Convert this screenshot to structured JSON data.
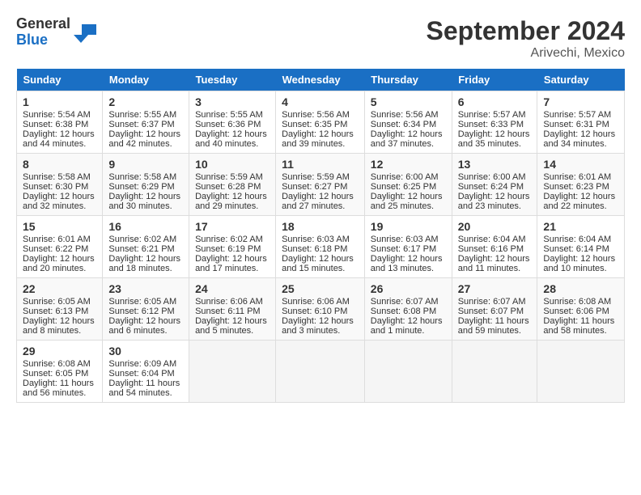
{
  "header": {
    "logo_line1": "General",
    "logo_line2": "Blue",
    "title": "September 2024",
    "subtitle": "Arivechi, Mexico"
  },
  "days_of_week": [
    "Sunday",
    "Monday",
    "Tuesday",
    "Wednesday",
    "Thursday",
    "Friday",
    "Saturday"
  ],
  "weeks": [
    [
      {
        "day": "1",
        "info": "Sunrise: 5:54 AM\nSunset: 6:38 PM\nDaylight: 12 hours\nand 44 minutes."
      },
      {
        "day": "2",
        "info": "Sunrise: 5:55 AM\nSunset: 6:37 PM\nDaylight: 12 hours\nand 42 minutes."
      },
      {
        "day": "3",
        "info": "Sunrise: 5:55 AM\nSunset: 6:36 PM\nDaylight: 12 hours\nand 40 minutes."
      },
      {
        "day": "4",
        "info": "Sunrise: 5:56 AM\nSunset: 6:35 PM\nDaylight: 12 hours\nand 39 minutes."
      },
      {
        "day": "5",
        "info": "Sunrise: 5:56 AM\nSunset: 6:34 PM\nDaylight: 12 hours\nand 37 minutes."
      },
      {
        "day": "6",
        "info": "Sunrise: 5:57 AM\nSunset: 6:33 PM\nDaylight: 12 hours\nand 35 minutes."
      },
      {
        "day": "7",
        "info": "Sunrise: 5:57 AM\nSunset: 6:31 PM\nDaylight: 12 hours\nand 34 minutes."
      }
    ],
    [
      {
        "day": "8",
        "info": "Sunrise: 5:58 AM\nSunset: 6:30 PM\nDaylight: 12 hours\nand 32 minutes."
      },
      {
        "day": "9",
        "info": "Sunrise: 5:58 AM\nSunset: 6:29 PM\nDaylight: 12 hours\nand 30 minutes."
      },
      {
        "day": "10",
        "info": "Sunrise: 5:59 AM\nSunset: 6:28 PM\nDaylight: 12 hours\nand 29 minutes."
      },
      {
        "day": "11",
        "info": "Sunrise: 5:59 AM\nSunset: 6:27 PM\nDaylight: 12 hours\nand 27 minutes."
      },
      {
        "day": "12",
        "info": "Sunrise: 6:00 AM\nSunset: 6:25 PM\nDaylight: 12 hours\nand 25 minutes."
      },
      {
        "day": "13",
        "info": "Sunrise: 6:00 AM\nSunset: 6:24 PM\nDaylight: 12 hours\nand 23 minutes."
      },
      {
        "day": "14",
        "info": "Sunrise: 6:01 AM\nSunset: 6:23 PM\nDaylight: 12 hours\nand 22 minutes."
      }
    ],
    [
      {
        "day": "15",
        "info": "Sunrise: 6:01 AM\nSunset: 6:22 PM\nDaylight: 12 hours\nand 20 minutes."
      },
      {
        "day": "16",
        "info": "Sunrise: 6:02 AM\nSunset: 6:21 PM\nDaylight: 12 hours\nand 18 minutes."
      },
      {
        "day": "17",
        "info": "Sunrise: 6:02 AM\nSunset: 6:19 PM\nDaylight: 12 hours\nand 17 minutes."
      },
      {
        "day": "18",
        "info": "Sunrise: 6:03 AM\nSunset: 6:18 PM\nDaylight: 12 hours\nand 15 minutes."
      },
      {
        "day": "19",
        "info": "Sunrise: 6:03 AM\nSunset: 6:17 PM\nDaylight: 12 hours\nand 13 minutes."
      },
      {
        "day": "20",
        "info": "Sunrise: 6:04 AM\nSunset: 6:16 PM\nDaylight: 12 hours\nand 11 minutes."
      },
      {
        "day": "21",
        "info": "Sunrise: 6:04 AM\nSunset: 6:14 PM\nDaylight: 12 hours\nand 10 minutes."
      }
    ],
    [
      {
        "day": "22",
        "info": "Sunrise: 6:05 AM\nSunset: 6:13 PM\nDaylight: 12 hours\nand 8 minutes."
      },
      {
        "day": "23",
        "info": "Sunrise: 6:05 AM\nSunset: 6:12 PM\nDaylight: 12 hours\nand 6 minutes."
      },
      {
        "day": "24",
        "info": "Sunrise: 6:06 AM\nSunset: 6:11 PM\nDaylight: 12 hours\nand 5 minutes."
      },
      {
        "day": "25",
        "info": "Sunrise: 6:06 AM\nSunset: 6:10 PM\nDaylight: 12 hours\nand 3 minutes."
      },
      {
        "day": "26",
        "info": "Sunrise: 6:07 AM\nSunset: 6:08 PM\nDaylight: 12 hours\nand 1 minute."
      },
      {
        "day": "27",
        "info": "Sunrise: 6:07 AM\nSunset: 6:07 PM\nDaylight: 11 hours\nand 59 minutes."
      },
      {
        "day": "28",
        "info": "Sunrise: 6:08 AM\nSunset: 6:06 PM\nDaylight: 11 hours\nand 58 minutes."
      }
    ],
    [
      {
        "day": "29",
        "info": "Sunrise: 6:08 AM\nSunset: 6:05 PM\nDaylight: 11 hours\nand 56 minutes."
      },
      {
        "day": "30",
        "info": "Sunrise: 6:09 AM\nSunset: 6:04 PM\nDaylight: 11 hours\nand 54 minutes."
      },
      null,
      null,
      null,
      null,
      null
    ]
  ]
}
